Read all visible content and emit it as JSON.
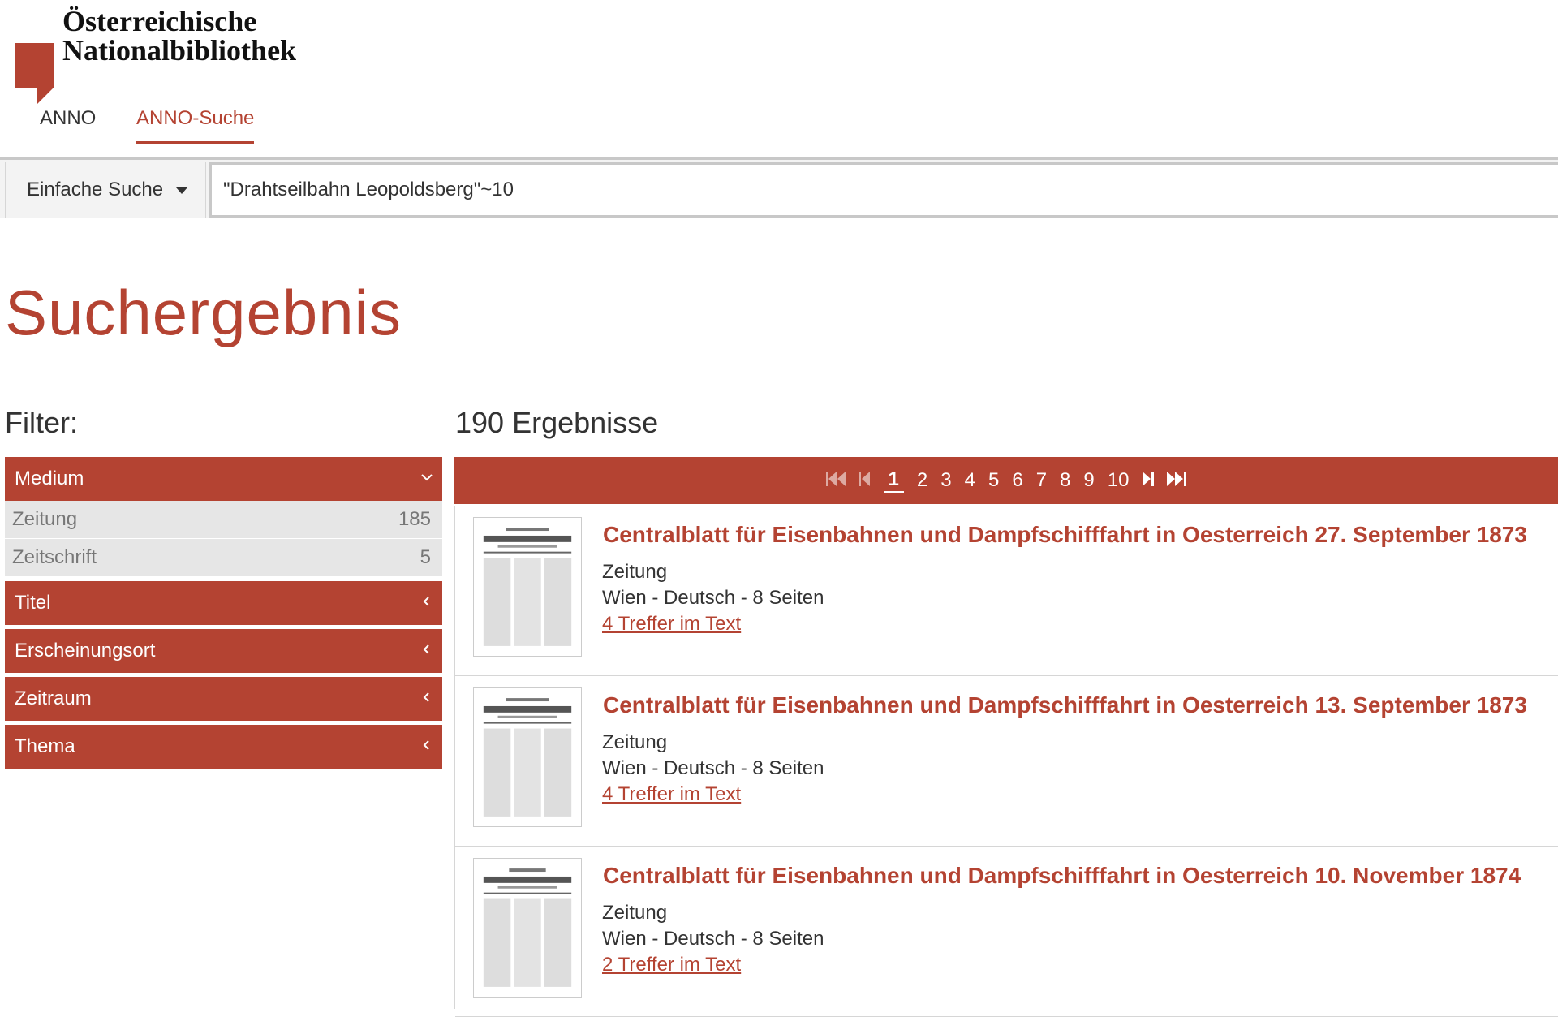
{
  "brand": {
    "line1": "Österreichische",
    "line2": "Nationalbibliothek",
    "color": "#b44332"
  },
  "nav": {
    "items": [
      {
        "label": "ANNO",
        "active": false
      },
      {
        "label": "ANNO-Suche",
        "active": true
      }
    ]
  },
  "search": {
    "mode": "Einfache Suche",
    "query": "\"Drahtseilbahn Leopoldsberg\"~10"
  },
  "page_title": "Suchergebnis",
  "filter_label": "Filter:",
  "results_count": "190 Ergebnisse",
  "facets": [
    {
      "label": "Medium",
      "expanded": true,
      "icon": "chevron-down-icon",
      "items": [
        {
          "label": "Zeitung",
          "count": "185"
        },
        {
          "label": "Zeitschrift",
          "count": "5"
        }
      ]
    },
    {
      "label": "Titel",
      "expanded": false,
      "icon": "chevron-left-icon"
    },
    {
      "label": "Erscheinungsort",
      "expanded": false,
      "icon": "chevron-left-icon"
    },
    {
      "label": "Zeitraum",
      "expanded": false,
      "icon": "chevron-left-icon"
    },
    {
      "label": "Thema",
      "expanded": false,
      "icon": "chevron-left-icon"
    }
  ],
  "pagination": {
    "pages": [
      "1",
      "2",
      "3",
      "4",
      "5",
      "6",
      "7",
      "8",
      "9",
      "10"
    ],
    "current": "1",
    "icons": [
      "first-page-icon",
      "prev-page-icon",
      "next-page-icon",
      "last-page-icon"
    ]
  },
  "results": [
    {
      "title": "Centralblatt für Eisenbahnen und Dampfschifffahrt in Oesterreich 27. September 1873",
      "type": "Zeitung",
      "meta": "Wien - Deutsch - 8 Seiten",
      "hits": "4 Treffer im Text"
    },
    {
      "title": "Centralblatt für Eisenbahnen und Dampfschifffahrt in Oesterreich 13. September 1873",
      "type": "Zeitung",
      "meta": "Wien - Deutsch - 8 Seiten",
      "hits": "4 Treffer im Text"
    },
    {
      "title": "Centralblatt für Eisenbahnen und Dampfschifffahrt in Oesterreich 10. November 1874",
      "type": "Zeitung",
      "meta": "Wien - Deutsch - 8 Seiten",
      "hits": "2 Treffer im Text"
    }
  ]
}
